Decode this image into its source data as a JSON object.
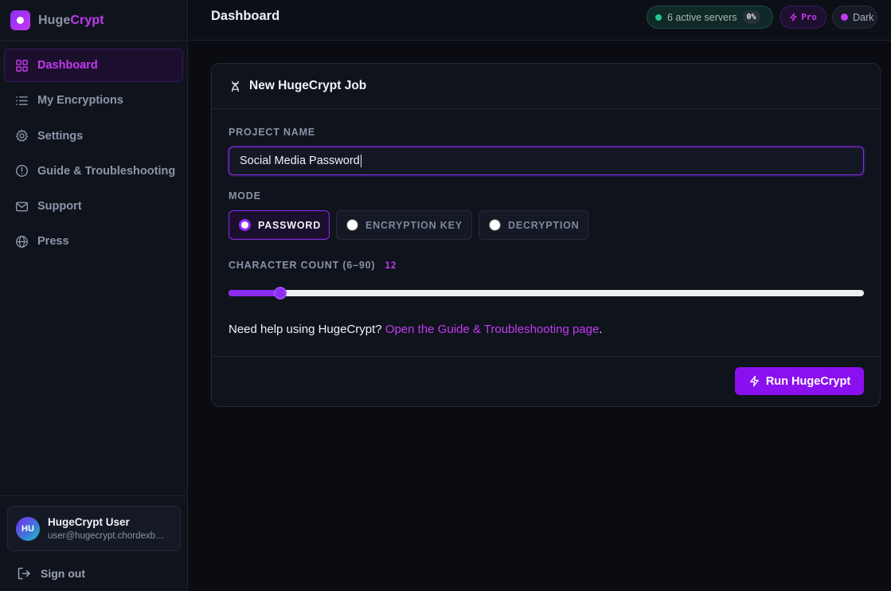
{
  "brand": {
    "name_a": "Huge",
    "name_b": "Crypt"
  },
  "sidebar": {
    "items": [
      {
        "label": "Dashboard",
        "icon": "grid-icon",
        "active": true
      },
      {
        "label": "My Encryptions",
        "icon": "list-icon"
      },
      {
        "label": "Settings",
        "icon": "gear-icon"
      },
      {
        "label": "Guide & Troubleshooting",
        "icon": "info-icon"
      },
      {
        "label": "Support",
        "icon": "mail-icon"
      },
      {
        "label": "Press",
        "icon": "globe-icon"
      }
    ],
    "user": {
      "initials": "HU",
      "name": "HugeCrypt User",
      "email": "user@hugecrypt.chordexbeats.com"
    },
    "signout_label": "Sign out"
  },
  "header": {
    "title": "Dashboard",
    "servers_label": "6 active servers",
    "servers_pct": "0%",
    "pro_label": "Pro",
    "theme_label": "Dark"
  },
  "job": {
    "title": "New HugeCrypt Job",
    "project_label": "PROJECT NAME",
    "project_value": "Social Media Password",
    "mode_label": "MODE",
    "modes": [
      "PASSWORD",
      "ENCRYPTION KEY",
      "DECRYPTION"
    ],
    "selected_mode": "PASSWORD",
    "count_label": "CHARACTER COUNT (6–90)",
    "count_min": 6,
    "count_max": 90,
    "count_value": "12",
    "help_text": "Need help using HugeCrypt? ",
    "help_link": "Open the Guide & Troubleshooting page",
    "help_end": ".",
    "run_label": "Run HugeCrypt"
  },
  "colors": {
    "accent": "#8b2cf5",
    "accent_text": "#c43af0",
    "server_dot": "#1dc98a"
  }
}
